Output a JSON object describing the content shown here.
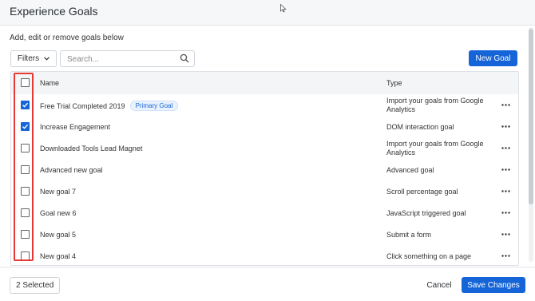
{
  "header": {
    "title": "Experience Goals"
  },
  "subtitle": "Add, edit or remove goals below",
  "toolbar": {
    "filters_label": "Filters",
    "search_placeholder": "Search...",
    "new_goal_label": "New Goal"
  },
  "table": {
    "columns": {
      "name": "Name",
      "type": "Type"
    },
    "rows": [
      {
        "name": "Free Trial Completed 2019",
        "badge": "Primary Goal",
        "type": "Import your goals from Google Analytics",
        "checked": true
      },
      {
        "name": "Increase Engagement",
        "badge": "",
        "type": "DOM interaction goal",
        "checked": true
      },
      {
        "name": "Downloaded Tools Lead Magnet",
        "badge": "",
        "type": "Import your goals from Google Analytics",
        "checked": false
      },
      {
        "name": "Advanced new goal",
        "badge": "",
        "type": "Advanced goal",
        "checked": false
      },
      {
        "name": "New goal 7",
        "badge": "",
        "type": "Scroll percentage goal",
        "checked": false
      },
      {
        "name": "Goal new 6",
        "badge": "",
        "type": "JavaScript triggered goal",
        "checked": false
      },
      {
        "name": "New goal 5",
        "badge": "",
        "type": "Submit a form",
        "checked": false
      },
      {
        "name": "New goal 4",
        "badge": "",
        "type": "Click something on a page",
        "checked": false
      }
    ]
  },
  "footer": {
    "selected_label": "2 Selected",
    "cancel_label": "Cancel",
    "save_label": "Save Changes"
  },
  "colors": {
    "accent": "#1565d8",
    "highlight": "#e53935"
  }
}
